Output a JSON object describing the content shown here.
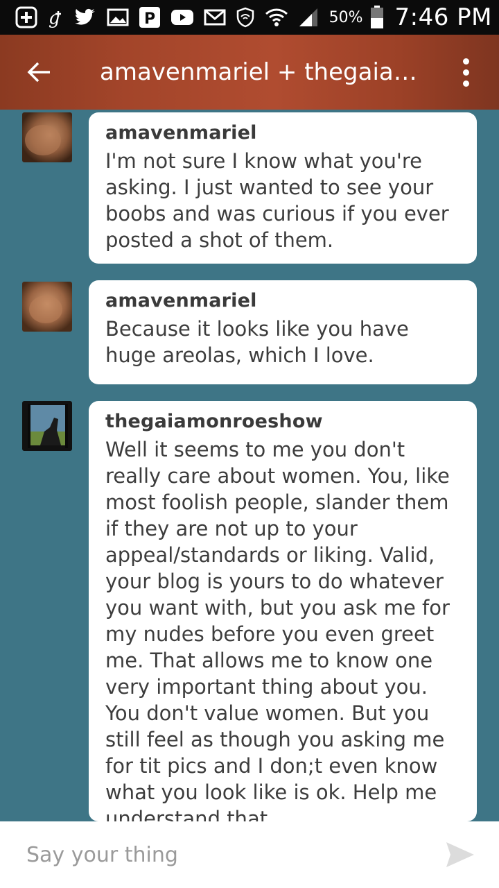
{
  "status_bar": {
    "battery_percent": "50%",
    "time": "7:46 PM",
    "icons": [
      "plus-icon",
      "gplus-icon",
      "twitter-icon",
      "gallery-icon",
      "pandora-icon",
      "youtube-icon",
      "gmail-icon",
      "shield-wifi-icon",
      "wifi-icon",
      "signal-icon",
      "battery-icon"
    ]
  },
  "app_bar": {
    "title": "amavenmariel + thegaiamonroeshow",
    "back_icon": "back-arrow-icon",
    "menu_icon": "overflow-menu-icon",
    "color": "#a3452a"
  },
  "messages": [
    {
      "sender": "amavenmariel",
      "text": "I'm not sure I know what you're asking. I just wanted to see your boobs and was curious if you ever posted a shot of them."
    },
    {
      "sender": "amavenmariel",
      "text": "Because it looks like you have huge areolas, which I love."
    },
    {
      "sender": "thegaiamonroeshow",
      "text": "Well it seems to me you don't really care about women. You, like most foolish people, slander them if they are not up to your appeal/standards or liking. Valid, your blog is yours to do whatever you want with, but you ask me for my nudes before you even greet me. That allows me to know one very important thing about you. You don't value women. But you still feel as though you asking me for tit pics and I don;t even know what you look like is ok. Help me understand that."
    }
  ],
  "composer": {
    "placeholder": "Say your thing",
    "send_icon": "send-icon"
  },
  "colors": {
    "background": "#3e7586",
    "bubble": "#ffffff",
    "status_bar": "#0b0b0b"
  }
}
